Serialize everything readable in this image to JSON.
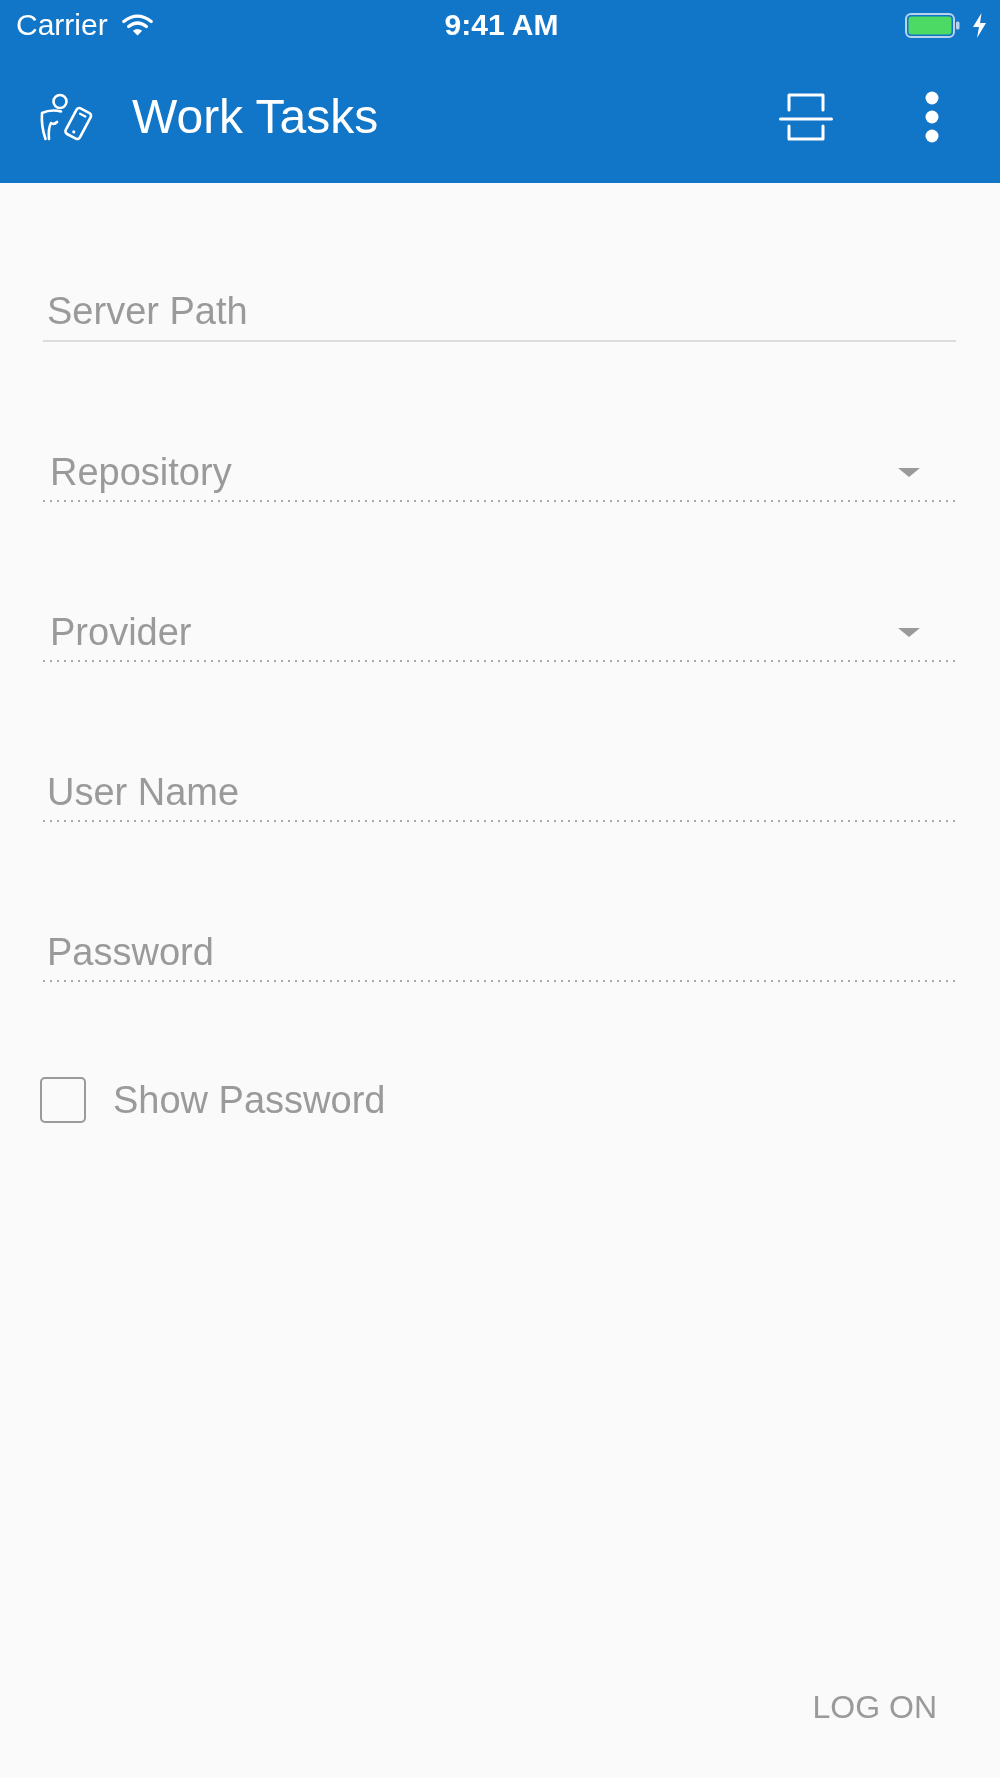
{
  "status_bar": {
    "carrier": "Carrier",
    "time": "9:41 AM"
  },
  "app_bar": {
    "title": "Work Tasks"
  },
  "fields": [
    {
      "kind": "text",
      "placeholder": "Server Path",
      "disabled": false
    },
    {
      "kind": "dropdown",
      "placeholder": "Repository",
      "disabled": true
    },
    {
      "kind": "dropdown",
      "placeholder": "Provider",
      "disabled": true
    },
    {
      "kind": "text",
      "placeholder": "User Name",
      "disabled": true
    },
    {
      "kind": "password",
      "placeholder": "Password",
      "disabled": true
    }
  ],
  "show_password": {
    "label": "Show Password",
    "checked": false
  },
  "log_on_button": {
    "label": "LOG ON",
    "disabled": true
  }
}
